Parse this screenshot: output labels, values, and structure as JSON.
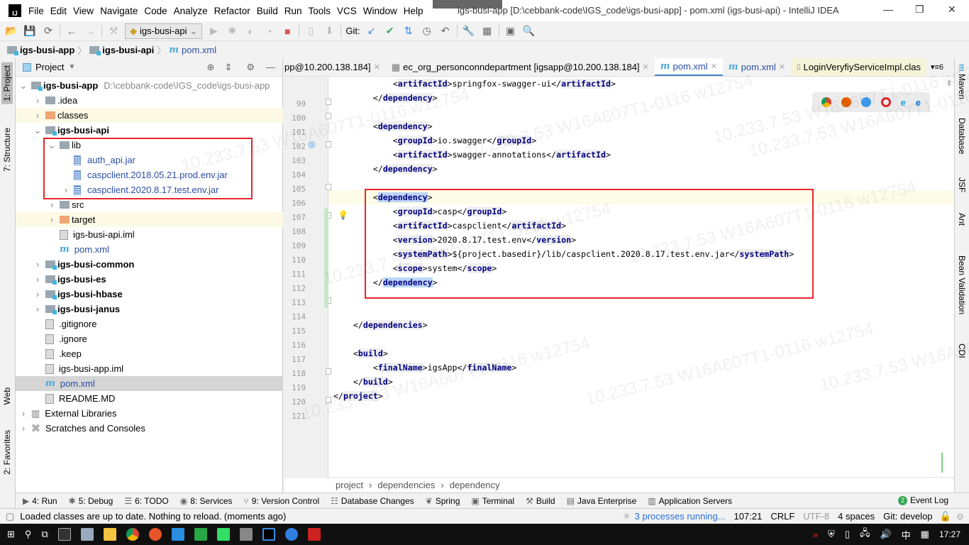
{
  "window": {
    "title": "igs-busi-app [D:\\cebbank-code\\IGS_code\\igs-busi-app] - pom.xml (igs-busi-api) - IntelliJ IDEA",
    "menu": [
      "File",
      "Edit",
      "View",
      "Navigate",
      "Code",
      "Analyze",
      "Refactor",
      "Build",
      "Run",
      "Tools",
      "VCS",
      "Window",
      "Help"
    ]
  },
  "toolbar": {
    "run_config": "igs-busi-api",
    "git_label": "Git:"
  },
  "navbar": {
    "crumbs": [
      "igs-busi-app",
      "igs-busi-api",
      "pom.xml"
    ]
  },
  "left_stripe": {
    "tabs": [
      "1: Project",
      "7: Structure",
      "Web",
      "2: Favorites"
    ]
  },
  "project_panel": {
    "title": "Project",
    "tree": [
      {
        "label": "igs-busi-app",
        "extra": "D:\\cebbank-code\\IGS_code\\igs-busi-app",
        "depth": 0,
        "arrow": "open",
        "icon": "module-folder",
        "bold": true
      },
      {
        "label": ".idea",
        "depth": 1,
        "arrow": "closed",
        "icon": "folder"
      },
      {
        "label": "classes",
        "depth": 1,
        "arrow": "closed",
        "icon": "orange-folder",
        "highlight": true
      },
      {
        "label": "igs-busi-api",
        "depth": 1,
        "arrow": "open",
        "icon": "module-folder",
        "bold": true
      },
      {
        "label": "lib",
        "depth": 2,
        "arrow": "open",
        "icon": "folder"
      },
      {
        "label": "auth_api.jar",
        "depth": 3,
        "arrow": "",
        "icon": "jar",
        "blue": true
      },
      {
        "label": "caspclient.2018.05.21.prod.env.jar",
        "depth": 3,
        "arrow": "",
        "icon": "jar",
        "blue": true
      },
      {
        "label": "caspclient.2020.8.17.test.env.jar",
        "depth": 3,
        "arrow": "closed",
        "icon": "jar",
        "blue": true
      },
      {
        "label": "src",
        "depth": 2,
        "arrow": "closed",
        "icon": "folder"
      },
      {
        "label": "target",
        "depth": 2,
        "arrow": "closed",
        "icon": "orange-folder",
        "highlight": true
      },
      {
        "label": "igs-busi-api.iml",
        "depth": 2,
        "arrow": "",
        "icon": "file"
      },
      {
        "label": "pom.xml",
        "depth": 2,
        "arrow": "",
        "icon": "maven",
        "blue": true
      },
      {
        "label": "igs-busi-common",
        "depth": 1,
        "arrow": "closed",
        "icon": "module-folder",
        "bold": true
      },
      {
        "label": "igs-busi-es",
        "depth": 1,
        "arrow": "closed",
        "icon": "module-folder",
        "bold": true
      },
      {
        "label": "igs-busi-hbase",
        "depth": 1,
        "arrow": "closed",
        "icon": "module-folder",
        "bold": true
      },
      {
        "label": "igs-busi-janus",
        "depth": 1,
        "arrow": "closed",
        "icon": "module-folder",
        "bold": true
      },
      {
        "label": ".gitignore",
        "depth": 1,
        "arrow": "",
        "icon": "file"
      },
      {
        "label": ".ignore",
        "depth": 1,
        "arrow": "",
        "icon": "file"
      },
      {
        "label": ".keep",
        "depth": 1,
        "arrow": "",
        "icon": "file"
      },
      {
        "label": "igs-busi-app.iml",
        "depth": 1,
        "arrow": "",
        "icon": "file"
      },
      {
        "label": "pom.xml",
        "depth": 1,
        "arrow": "",
        "icon": "maven",
        "blue": true,
        "selected": true
      },
      {
        "label": "README.MD",
        "depth": 1,
        "arrow": "",
        "icon": "file"
      },
      {
        "label": "External Libraries",
        "depth": 0,
        "arrow": "closed",
        "icon": "library"
      },
      {
        "label": "Scratches and Consoles",
        "depth": 0,
        "arrow": "closed",
        "icon": "scratch"
      }
    ]
  },
  "editor": {
    "tabs": [
      {
        "label": "pp@10.200.138.184]",
        "icon": "db"
      },
      {
        "label": "ec_org_personconndepartment [igsapp@10.200.138.184]",
        "icon": "table"
      },
      {
        "label": "pom.xml",
        "icon": "maven",
        "active": true
      },
      {
        "label": "pom.xml",
        "icon": "maven"
      },
      {
        "label": "LoginVeryfiyServiceImpl.clas",
        "icon": "class",
        "yellow": true
      }
    ],
    "tab_overflow": "6",
    "lines": [
      {
        "n": "99",
        "indent": 3,
        "text": "<artifactId>springfox-swagger-ui</artifactId>"
      },
      {
        "n": "100",
        "indent": 2,
        "text": "</dependency>"
      },
      {
        "n": "101",
        "indent": 0,
        "text": ""
      },
      {
        "n": "102",
        "indent": 2,
        "text": "<dependency>"
      },
      {
        "n": "103",
        "indent": 3,
        "text": "<groupId>io.swagger</groupId>"
      },
      {
        "n": "104",
        "indent": 3,
        "text": "<artifactId>swagger-annotations</artifactId>"
      },
      {
        "n": "105",
        "indent": 2,
        "text": "</dependency>"
      },
      {
        "n": "106",
        "indent": 0,
        "text": ""
      },
      {
        "n": "107",
        "indent": 2,
        "text": "<dependency>",
        "hl": true
      },
      {
        "n": "108",
        "indent": 3,
        "text": "<groupId>casp</groupId>"
      },
      {
        "n": "109",
        "indent": 3,
        "text": "<artifactId>caspclient</artifactId>"
      },
      {
        "n": "110",
        "indent": 3,
        "text": "<version>2020.8.17.test.env</version>"
      },
      {
        "n": "111",
        "indent": 3,
        "text": "<systemPath>${project.basedir}/lib/caspclient.2020.8.17.test.env.jar</systemPath>"
      },
      {
        "n": "112",
        "indent": 3,
        "text": "<scope>system</scope>"
      },
      {
        "n": "113",
        "indent": 2,
        "text": "</dependency>",
        "hl": true
      },
      {
        "n": "114",
        "indent": 0,
        "text": ""
      },
      {
        "n": "115",
        "indent": 0,
        "text": ""
      },
      {
        "n": "116",
        "indent": 1,
        "text": "</dependencies>"
      },
      {
        "n": "117",
        "indent": 0,
        "text": ""
      },
      {
        "n": "118",
        "indent": 1,
        "text": "<build>"
      },
      {
        "n": "119",
        "indent": 2,
        "text": "<finalName>igsApp</finalName>"
      },
      {
        "n": "120",
        "indent": 1,
        "text": "</build>"
      },
      {
        "n": "121",
        "indent": 0,
        "text": "</project>"
      }
    ],
    "breadcrumb": [
      "project",
      "dependencies",
      "dependency"
    ]
  },
  "right_stripe": {
    "tabs": [
      "Maven",
      "Database",
      "JSF",
      "Ant",
      "Bean Validation",
      "CDI"
    ]
  },
  "tool_windows": [
    {
      "label": "4: Run",
      "icon": "run"
    },
    {
      "label": "5: Debug",
      "icon": "debug"
    },
    {
      "label": "6: TODO",
      "icon": "todo"
    },
    {
      "label": "8: Services",
      "icon": "services"
    },
    {
      "label": "9: Version Control",
      "icon": "vcs"
    },
    {
      "label": "Database Changes",
      "icon": "database"
    },
    {
      "label": "Spring",
      "icon": "spring"
    },
    {
      "label": "Terminal",
      "icon": "terminal"
    },
    {
      "label": "Build",
      "icon": "build"
    },
    {
      "label": "Java Enterprise",
      "icon": "javaee"
    },
    {
      "label": "Application Servers",
      "icon": "server"
    }
  ],
  "event_log": {
    "label": "Event Log",
    "count": "2"
  },
  "status": {
    "message": "Loaded classes are up to date. Nothing to reload. (moments ago)",
    "processes": "3 processes running...",
    "position": "107:21",
    "line_sep": "CRLF",
    "encoding": "UTF-8",
    "indent": "4 spaces",
    "git": "Git: develop"
  },
  "taskbar": {
    "time": "17:27",
    "ime": "中"
  },
  "watermark": "10.233.7.53 W16A607T1-0116 w12754",
  "colors": {
    "accent": "#4083c9",
    "highlight_box": "#e8262a",
    "tag": "#000080"
  }
}
